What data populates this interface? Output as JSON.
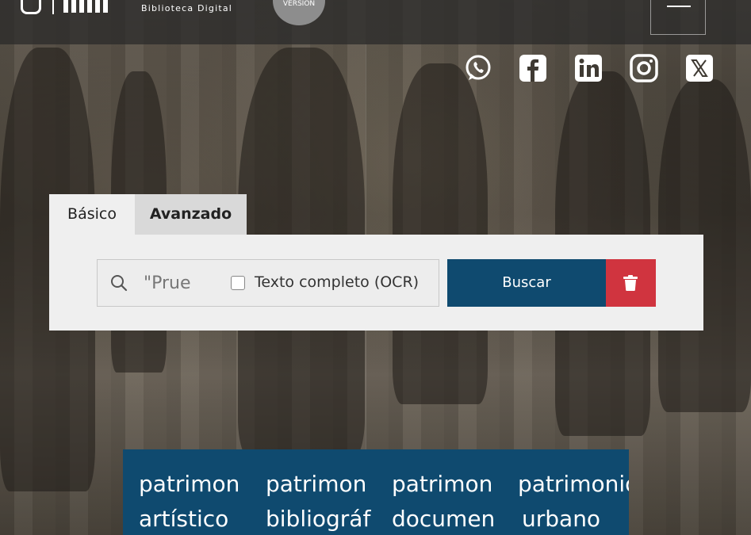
{
  "header": {
    "subtitle": "Biblioteca Digital",
    "version_badge": "VERSION",
    "menu_icon": "hamburger-icon"
  },
  "social": [
    {
      "name": "whatsapp",
      "icon": "whatsapp-icon"
    },
    {
      "name": "facebook",
      "icon": "facebook-icon"
    },
    {
      "name": "linkedin",
      "icon": "linkedin-icon"
    },
    {
      "name": "instagram",
      "icon": "instagram-icon"
    },
    {
      "name": "x",
      "icon": "x-icon"
    }
  ],
  "search": {
    "tabs": [
      {
        "label": "Básico",
        "active": true
      },
      {
        "label": "Avanzado",
        "active": false
      }
    ],
    "input_value": "\"Prue",
    "ocr_label": "Texto completo (OCR)",
    "ocr_checked": false,
    "button_label": "Buscar",
    "clear_icon": "trash-icon"
  },
  "categories": [
    {
      "line1": "patrimon",
      "line2": "artístico"
    },
    {
      "line1": "patrimon",
      "line2": "bibliográf"
    },
    {
      "line1": "patrimon",
      "line2": "documen"
    },
    {
      "line1": "patrimonio",
      "line2": "urbano"
    }
  ],
  "colors": {
    "primary": "#0f4a6f",
    "danger": "#d0343f",
    "panel": "#efefef"
  }
}
